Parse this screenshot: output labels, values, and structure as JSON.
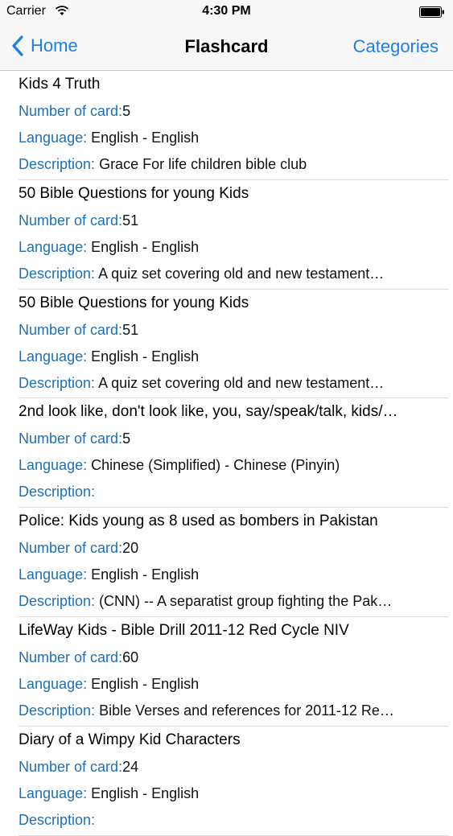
{
  "status_bar": {
    "carrier": "Carrier",
    "time": "4:30 PM"
  },
  "nav": {
    "back_label": "Home",
    "title": "Flashcard",
    "right_label": "Categories"
  },
  "labels": {
    "number": "Number of card:",
    "language": "Language:",
    "description": "Description:"
  },
  "colors": {
    "accent": "#1e7ee6",
    "label": "#1e6fb5"
  },
  "cards": [
    {
      "title": "Kids 4 Truth",
      "number": "5",
      "language": "English - English",
      "description": "Grace For life children bible club"
    },
    {
      "title": "50 Bible Questions for young Kids",
      "number": "51",
      "language": "English - English",
      "description": "A quiz set covering old and new testament…"
    },
    {
      "title": "50 Bible Questions for young Kids",
      "number": "51",
      "language": "English - English",
      "description": "A quiz set covering old and new testament…"
    },
    {
      "title": "2nd look like, don't look like, you, say/speak/talk, kids/…",
      "number": "5",
      "language": "Chinese (Simplified) - Chinese (Pinyin)",
      "description": ""
    },
    {
      "title": "Police: Kids young as 8 used as bombers in Pakistan",
      "number": "20",
      "language": "English - English",
      "description": "(CNN) -- A separatist group fighting the Pak…"
    },
    {
      "title": "LifeWay Kids - Bible Drill 2011-12 Red Cycle NIV",
      "number": "60",
      "language": "English - English",
      "description": "Bible Verses and references for 2011-12 Re…"
    },
    {
      "title": "Diary of a Wimpy Kid Characters",
      "number": "24",
      "language": "English - English",
      "description": ""
    }
  ]
}
